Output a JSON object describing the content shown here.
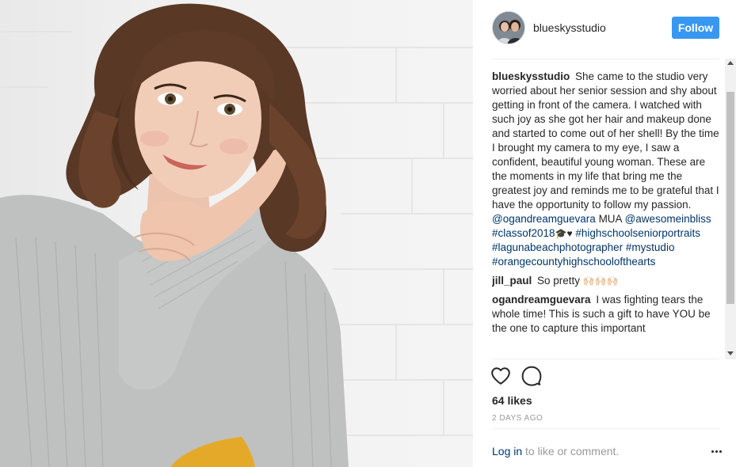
{
  "post": {
    "username": "blueskysstudio",
    "follow_label": "Follow",
    "likes": "64 likes",
    "time_ago": "2 DAYS AGO"
  },
  "caption": {
    "username": "blueskysstudio",
    "text": "She came to the studio very worried about her senior session and shy about getting in front of the camera. I watched with such joy as she got her hair and makeup done and started to come out of her shell! By the time I brought my camera to my eye, I saw a confident, beautiful young woman. These are the moments in my life that bring me the greatest joy and reminds me to be grateful that I have the opportunity to follow my passion.",
    "mention1": "@ogandreamguevara",
    "mua": "MUA",
    "mention2": "@awesomeinbliss",
    "hashtag1": "#classof2018",
    "hashtag1_emoji": "🎓♥",
    "hashtag2": "#highschoolseniorportraits",
    "hashtag3": "#lagunabeachphotographer",
    "hashtag4": "#mystudio",
    "hashtag5": "#orangecountyhighschoolofthearts"
  },
  "comments": [
    {
      "username": "jill_paul",
      "text": "So pretty",
      "emoji": "🙌🏻🙌🏻🙌🏻"
    },
    {
      "username": "ogandreamguevara",
      "text": "I was fighting tears the whole time! This is such a gift to have YOU be the one to capture this important"
    }
  ],
  "footer": {
    "login_label": "Log in",
    "rest_label": " to like or comment."
  },
  "icons": {
    "like": "heart-icon",
    "comment": "comment-icon",
    "more": "more-options-icon"
  },
  "colors": {
    "follow_button": "#3897f0",
    "link": "#003569",
    "muted": "#999999"
  }
}
